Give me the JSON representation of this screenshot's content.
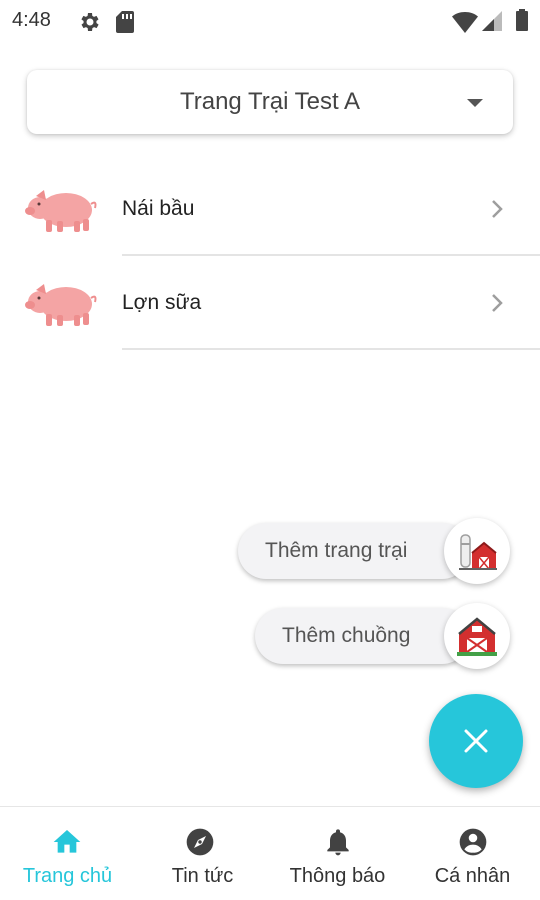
{
  "status_bar": {
    "time": "4:48",
    "icons": [
      "gear-icon",
      "sd-card-icon",
      "wifi-icon",
      "signal-icon",
      "battery-icon"
    ]
  },
  "farm_selector": {
    "selected": "Trang Trại Test A",
    "icon": "dropdown-arrow-icon"
  },
  "barns": [
    {
      "label": "Nái bầu",
      "icon": "pig-icon"
    },
    {
      "label": "Lợn sữa",
      "icon": "pig-icon"
    }
  ],
  "speed_dial": {
    "actions": [
      {
        "label": "Thêm trang trại",
        "icon": "farm-silo-icon"
      },
      {
        "label": "Thêm chuồng",
        "icon": "barn-icon"
      }
    ],
    "fab_icon": "close-icon"
  },
  "bottom_nav": {
    "items": [
      {
        "label": "Trang chủ",
        "icon": "home-icon",
        "active": true
      },
      {
        "label": "Tin tức",
        "icon": "compass-icon",
        "active": false
      },
      {
        "label": "Thông báo",
        "icon": "bell-icon",
        "active": false
      },
      {
        "label": "Cá nhân",
        "icon": "account-icon",
        "active": false
      }
    ]
  },
  "colors": {
    "accent": "#26c6da",
    "pig_pink": "#f4a4a4",
    "barn_red": "#d32f2f"
  }
}
